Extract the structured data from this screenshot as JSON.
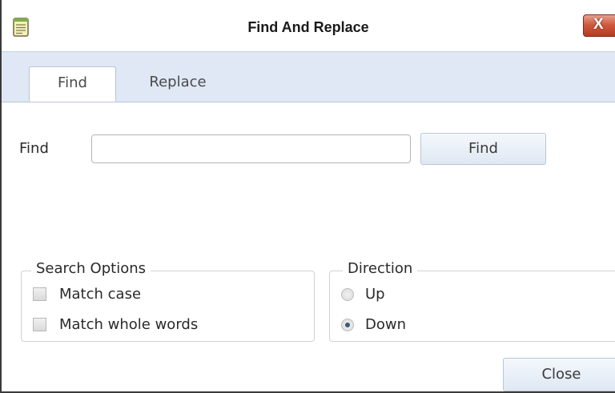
{
  "window": {
    "title": "Find And Replace",
    "close_glyph": "X"
  },
  "tabs": [
    {
      "label": "Find",
      "selected": true
    },
    {
      "label": "Replace",
      "selected": false
    }
  ],
  "find_row": {
    "label": "Find",
    "input_value": "",
    "button_label": "Find"
  },
  "search_options": {
    "legend": "Search Options",
    "items": [
      {
        "label": "Match case",
        "checked": false
      },
      {
        "label": "Match whole words",
        "checked": false
      }
    ]
  },
  "direction": {
    "legend": "Direction",
    "options": [
      {
        "label": "Up",
        "selected": false
      },
      {
        "label": "Down",
        "selected": true
      }
    ]
  },
  "footer": {
    "close_label": "Close"
  },
  "colors": {
    "tab_strip": "#dfe8f4",
    "close_button_red": "#cf5a40",
    "accent": "#3a5a7a"
  },
  "icons": {
    "app": "notepad-icon",
    "close": "close-icon"
  }
}
